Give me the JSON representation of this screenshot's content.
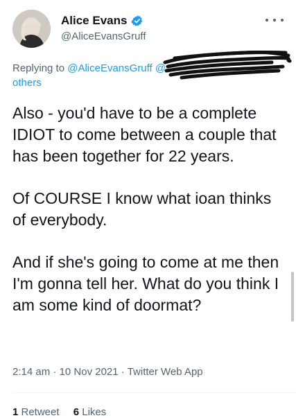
{
  "author": {
    "display_name": "Alice Evans",
    "handle": "@AliceEvansGruff",
    "avatar_icon": "avatar-photo",
    "verified_icon": "verified-badge-icon"
  },
  "reply": {
    "prefix": "Replying to ",
    "mention": "@AliceEvansGruff",
    "mention2": "@",
    "others": "others"
  },
  "tweet": {
    "paragraphs": [
      "Also - you'd have to be a complete IDIOT to come between a couple that has been together for 22 years.",
      "Of COURSE I know what ioan thinks of everybody.",
      "And if she's going to come at me then I'm gonna tell her. What do you think I am some kind of doormat?"
    ]
  },
  "meta": {
    "time": "2:14 am",
    "separator": " · ",
    "date": "10 Nov 2021",
    "source": "Twitter Web App"
  },
  "stats": {
    "retweets_count": "1",
    "retweets_label": " Retweet",
    "likes_count": "6",
    "likes_label": " Likes"
  },
  "colors": {
    "accent": "#1d9bf0",
    "secondary_text": "#536471",
    "primary_text": "#0f1419"
  }
}
